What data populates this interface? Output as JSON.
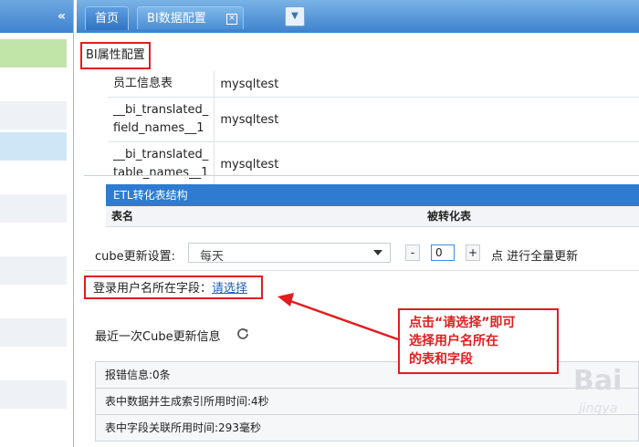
{
  "tabs": {
    "home": "首页",
    "current": "BI数据配置",
    "close_glyph": "×"
  },
  "section_title": "BI属性配置",
  "field_table": {
    "rows": [
      {
        "name": "员工信息表",
        "value": "mysqltest"
      },
      {
        "name": "__bi_translated_field_names__1",
        "value": "mysqltest"
      },
      {
        "name": "__bi_translated_table_names__1",
        "value": "mysqltest"
      }
    ],
    "row2_line1": "__bi_translated_",
    "row2_line2": "field_names__1",
    "row3_line1": "__bi_translated_",
    "row3_line2": "table_names__1"
  },
  "etl": {
    "title": "ETL转化表结构",
    "col_table": "表名",
    "col_converted": "被转化表"
  },
  "cube": {
    "label": "cube更新设置:",
    "select_value": "每天",
    "minus": "-",
    "plus": "+",
    "count": "0",
    "suffix": "点 进行全量更新"
  },
  "login_field": {
    "label": "登录用户名所在字段：",
    "link": "请选择"
  },
  "last_update": {
    "label": "最近一次Cube更新信息"
  },
  "info_rows": [
    "报错信息:0条",
    "表中数据并生成索引所用时间:4秒",
    "表中字段关联所用时间:293毫秒"
  ],
  "callout": {
    "line1": "点击“请选择”即可",
    "line2": "选择用户名所在",
    "line3": "的表和字段"
  },
  "watermark": {
    "logo": "Bai",
    "sub": "jingya"
  },
  "colors": {
    "accent": "#2e7bd1",
    "annotation": "#e21d1d",
    "link": "#1f5fb8",
    "sidebar_active": "#bfe6a8"
  },
  "icons": {
    "collapse": "double-chevron-left-icon",
    "dropdown": "caret-down-icon",
    "refresh": "refresh-icon"
  }
}
